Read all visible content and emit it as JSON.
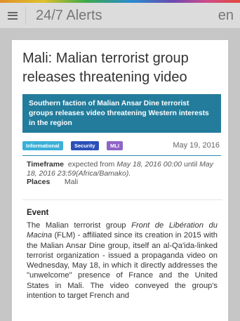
{
  "header": {
    "menu_icon": "hamburger-menu-icon",
    "title": "24/7 Alerts",
    "language": "en"
  },
  "colors": {
    "header_bg": "#dcdcdc",
    "summary_bg": "#237c9c",
    "tag_informational": "#3bb0d8",
    "tag_security": "#2b50b8",
    "tag_mli": "#8e64c8"
  },
  "article": {
    "title": "Mali: Malian terrorist group releases threatening video",
    "summary": "Southern faction of Malian Ansar Dine terrorist groups releases video threatening Western interests in the region",
    "tags": [
      "Informational",
      "Security",
      "MLI"
    ],
    "date": "May 19, 2016",
    "timeframe": {
      "label": "Timeframe",
      "text_expected": "expected from",
      "from": "May 18, 2016 00:00",
      "text_until": "until",
      "until": "May 18, 2016 23:59",
      "timezone": "(Africa/Bamako)."
    },
    "places": {
      "label": "Places",
      "value": "Mali"
    },
    "event": {
      "heading": "Event",
      "intro": "The Malian terrorist group",
      "group_name": "Front de Libération du Macina",
      "body": "(FLM) - affiliated since its creation in 2015 with the Malian Ansar Dine group, itself an al-Qa'ida-linked terrorist organization - issued a propaganda video on Wednesday, May 18, in which it directly addresses the \"unwelcome\" presence of France and the United States in Mali. The video conveyed the group's intention to target French and"
    }
  }
}
